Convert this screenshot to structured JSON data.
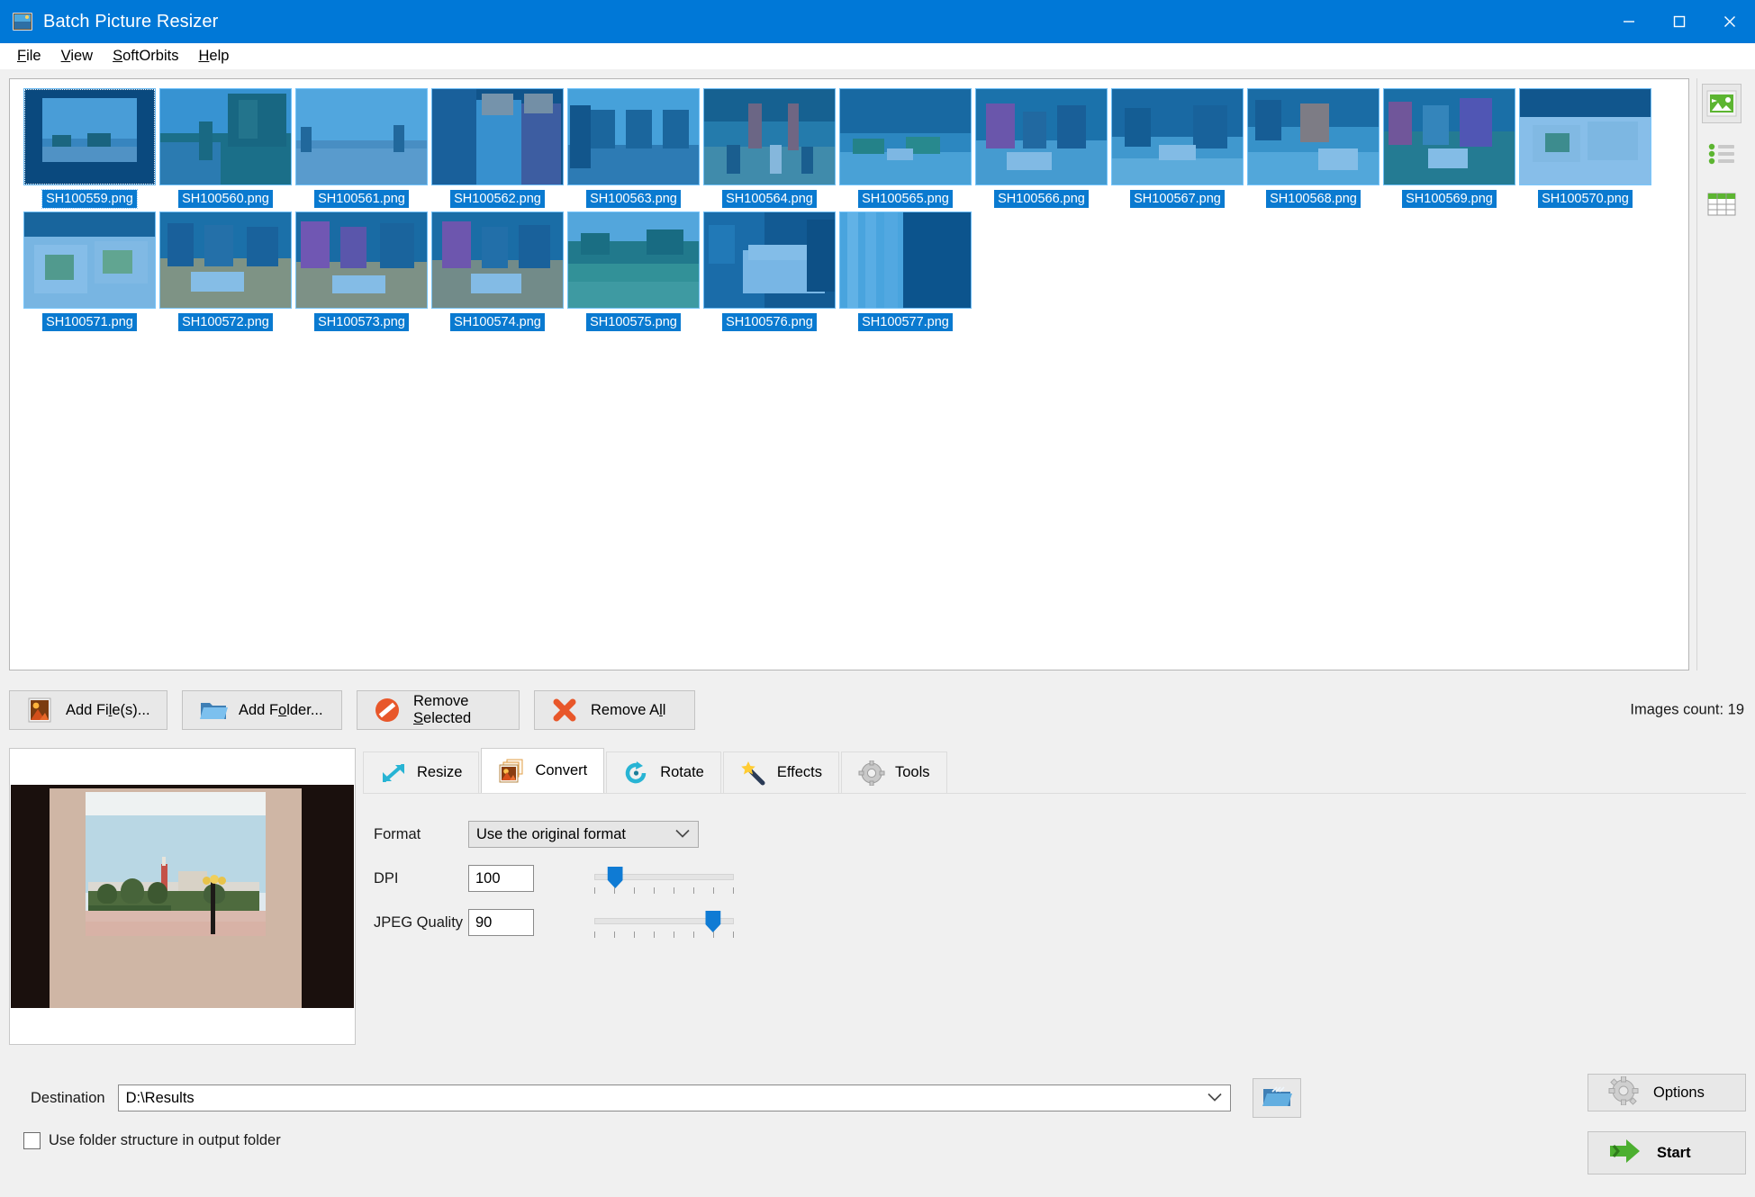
{
  "window": {
    "title": "Batch Picture Resizer",
    "icon": "app-picture-icon",
    "accent": "#0078d7",
    "minimize": "–",
    "maximize": "□",
    "close": "×"
  },
  "menu": {
    "items": [
      {
        "label": "File",
        "accel": "F"
      },
      {
        "label": "View",
        "accel": "V"
      },
      {
        "label": "SoftOrbits",
        "accel": "S"
      },
      {
        "label": "Help",
        "accel": "H"
      }
    ]
  },
  "thumbnails": {
    "selected_highlight": "#0078d7",
    "items": [
      {
        "name": "SH100559.png",
        "scene": "window-view",
        "focused": true
      },
      {
        "name": "SH100560.png",
        "scene": "garden-path"
      },
      {
        "name": "SH100561.png",
        "scene": "promenade"
      },
      {
        "name": "SH100562.png",
        "scene": "people-portrait"
      },
      {
        "name": "SH100563.png",
        "scene": "courtyard-arches"
      },
      {
        "name": "SH100564.png",
        "scene": "lobby-crowd"
      },
      {
        "name": "SH100565.png",
        "scene": "buffet-table"
      },
      {
        "name": "SH100566.png",
        "scene": "dining-guests"
      },
      {
        "name": "SH100567.png",
        "scene": "restaurant-interior"
      },
      {
        "name": "SH100568.png",
        "scene": "dinner-table"
      },
      {
        "name": "SH100569.png",
        "scene": "buffet-line"
      },
      {
        "name": "SH100570.png",
        "scene": "food-plate"
      },
      {
        "name": "SH100571.png",
        "scene": "meal-closeup"
      },
      {
        "name": "SH100572.png",
        "scene": "family-dining"
      },
      {
        "name": "SH100573.png",
        "scene": "group-table"
      },
      {
        "name": "SH100574.png",
        "scene": "guests-seated"
      },
      {
        "name": "SH100575.png",
        "scene": "garden-lawn"
      },
      {
        "name": "SH100576.png",
        "scene": "hotel-bedroom"
      },
      {
        "name": "SH100577.png",
        "scene": "curtain-window"
      }
    ]
  },
  "view_tools": {
    "items": [
      {
        "name": "thumbnail-view",
        "icon": "picture-icon",
        "active": true
      },
      {
        "name": "list-view",
        "icon": "list-icon",
        "active": false
      },
      {
        "name": "details-view",
        "icon": "grid-icon",
        "active": false
      }
    ]
  },
  "actions": {
    "add_files": {
      "label": "Add File(s)...",
      "accel": "l",
      "icon": "picture-icon"
    },
    "add_folder": {
      "label": "Add Folder...",
      "accel": "o",
      "icon": "folder-icon"
    },
    "remove_selected": {
      "label": "Remove Selected",
      "accel": "S",
      "icon": "no-entry-icon"
    },
    "remove_all": {
      "label": "Remove All",
      "accel": "A",
      "icon": "red-x-icon"
    },
    "images_count": "Images count: 19"
  },
  "tabs": [
    {
      "label": "Resize",
      "icon": "resize-arrow-icon",
      "active": false
    },
    {
      "label": "Convert",
      "icon": "convert-images-icon",
      "active": true
    },
    {
      "label": "Rotate",
      "icon": "rotate-arrow-icon",
      "active": false
    },
    {
      "label": "Effects",
      "icon": "magic-wand-icon",
      "active": false
    },
    {
      "label": "Tools",
      "icon": "gear-icon",
      "active": false
    }
  ],
  "convert_panel": {
    "format": {
      "label": "Format",
      "value": "Use the original format"
    },
    "dpi": {
      "label": "DPI",
      "value": "100",
      "slider_percent": 15
    },
    "jpeg_quality": {
      "label": "JPEG Quality",
      "value": "90",
      "slider_percent": 85
    }
  },
  "preview": {
    "name": "preview-pane",
    "scene": "resort-view-through-window"
  },
  "footer": {
    "destination_label": "Destination",
    "destination_value": "D:\\Results",
    "browse_icon": "open-folder-icon",
    "use_folder_structure": {
      "label": "Use folder structure in output folder",
      "checked": false
    },
    "options_button": {
      "label": "Options",
      "icon": "gear-icon"
    },
    "start_button": {
      "label": "Start",
      "icon": "green-arrow-icon"
    }
  }
}
